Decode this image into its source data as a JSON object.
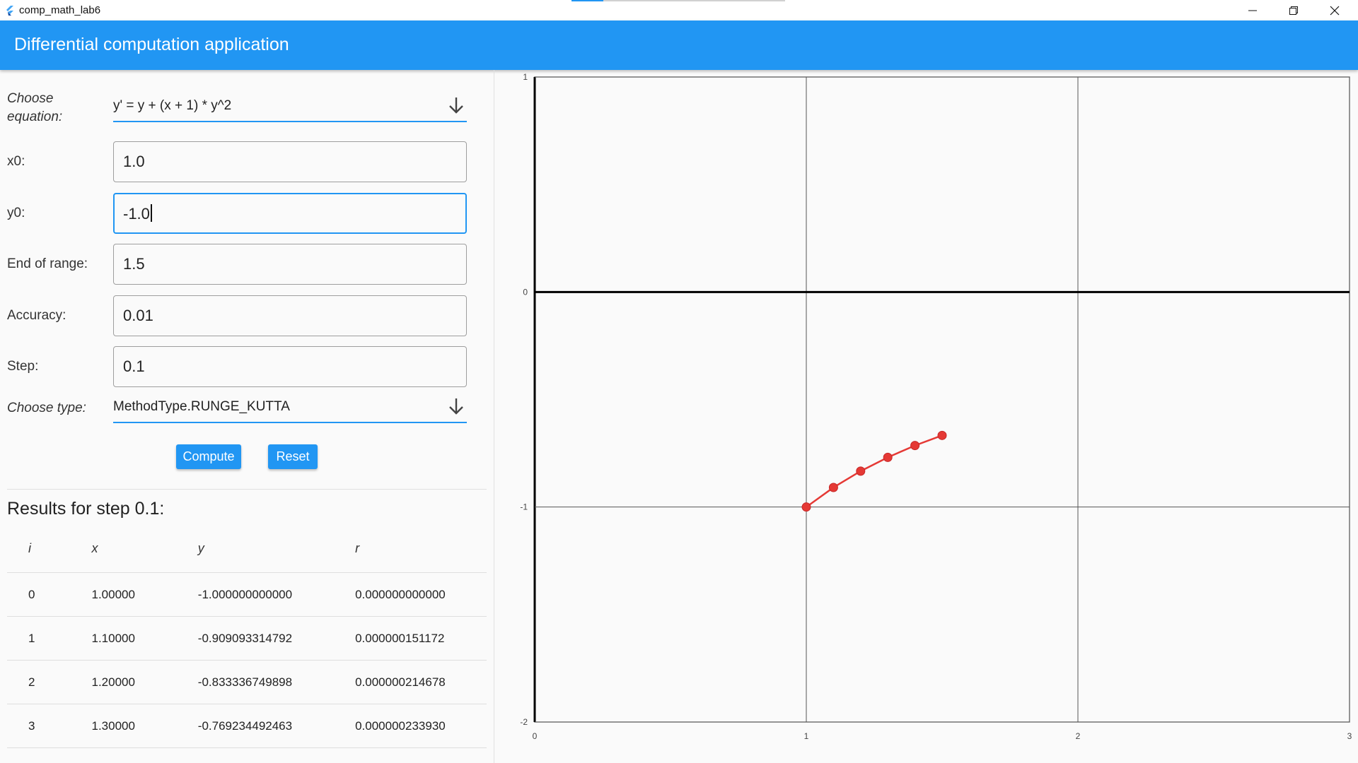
{
  "window": {
    "title": "comp_math_lab6",
    "loading_fraction": 0.15
  },
  "appbar": {
    "title": "Differential computation application"
  },
  "form": {
    "equation_label": "Choose equation:",
    "equation_value": "y' = y + (x + 1) * y^2",
    "x0_label": "x0:",
    "x0_value": "1.0",
    "y0_label": "y0:",
    "y0_value": "-1.0",
    "end_label": "End of range:",
    "end_value": "1.5",
    "accuracy_label": "Accuracy:",
    "accuracy_value": "0.01",
    "step_label": "Step:",
    "step_value": "0.1",
    "type_label": "Choose type:",
    "type_value": "MethodType.RUNGE_KUTTA",
    "compute_label": "Compute",
    "reset_label": "Reset"
  },
  "results": {
    "title": "Results for step 0.1:",
    "headers": [
      "i",
      "x",
      "y",
      "r"
    ],
    "rows": [
      [
        "0",
        "1.00000",
        "-1.000000000000",
        "0.000000000000"
      ],
      [
        "1",
        "1.10000",
        "-0.909093314792",
        "0.000000151172"
      ],
      [
        "2",
        "1.20000",
        "-0.833336749898",
        "0.000000214678"
      ],
      [
        "3",
        "1.30000",
        "-0.769234492463",
        "0.000000233930"
      ]
    ]
  },
  "colors": {
    "accent": "#2196f3",
    "series": "#e53935"
  },
  "chart_data": {
    "type": "line",
    "xlim": [
      0,
      3
    ],
    "ylim": [
      -2,
      1
    ],
    "x_ticks": [
      "0",
      "1",
      "2",
      "3"
    ],
    "y_ticks": [
      "1",
      "0",
      "-1",
      "-2"
    ],
    "grid": true,
    "series": [
      {
        "x": [
          1.0,
          1.1,
          1.2,
          1.3,
          1.4,
          1.5
        ],
        "y": [
          -1.0,
          -0.909,
          -0.833,
          -0.769,
          -0.714,
          -0.667
        ]
      }
    ]
  }
}
